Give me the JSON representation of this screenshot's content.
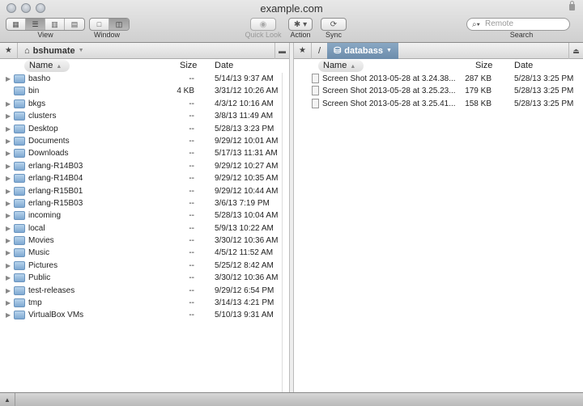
{
  "window": {
    "title": "example.com"
  },
  "toolbar": {
    "view_label": "View",
    "window_label": "Window",
    "quicklook_label": "Quick Look",
    "action_label": "Action",
    "sync_label": "Sync",
    "search_label": "Search",
    "search_placeholder": "Remote",
    "view_modes": [
      "icon-view",
      "list-view",
      "column-view",
      "coverflow-view"
    ],
    "view_selected": "list-view",
    "window_modes": [
      "single-pane",
      "dual-pane"
    ],
    "window_selected": "dual-pane"
  },
  "left": {
    "path": [
      {
        "label": "bshumate",
        "icon": "home-icon"
      }
    ],
    "columns": {
      "name": "Name",
      "size": "Size",
      "date": "Date"
    },
    "rows": [
      {
        "name": "basho",
        "size": "--",
        "date": "5/14/13 9:37 AM"
      },
      {
        "name": "bin",
        "size": "4 KB",
        "date": "3/31/12 10:26 AM",
        "alias": true
      },
      {
        "name": "bkgs",
        "size": "--",
        "date": "4/3/12 10:16 AM"
      },
      {
        "name": "clusters",
        "size": "--",
        "date": "3/8/13 11:49 AM"
      },
      {
        "name": "Desktop",
        "size": "--",
        "date": "5/28/13 3:23 PM"
      },
      {
        "name": "Documents",
        "size": "--",
        "date": "9/29/12 10:01 AM"
      },
      {
        "name": "Downloads",
        "size": "--",
        "date": "5/17/13 11:31 AM"
      },
      {
        "name": "erlang-R14B03",
        "size": "--",
        "date": "9/29/12 10:27 AM"
      },
      {
        "name": "erlang-R14B04",
        "size": "--",
        "date": "9/29/12 10:35 AM"
      },
      {
        "name": "erlang-R15B01",
        "size": "--",
        "date": "9/29/12 10:44 AM"
      },
      {
        "name": "erlang-R15B03",
        "size": "--",
        "date": "3/6/13 7:19 PM"
      },
      {
        "name": "incoming",
        "size": "--",
        "date": "5/28/13 10:04 AM"
      },
      {
        "name": "local",
        "size": "--",
        "date": "5/9/13 10:22 AM"
      },
      {
        "name": "Movies",
        "size": "--",
        "date": "3/30/12 10:36 AM"
      },
      {
        "name": "Music",
        "size": "--",
        "date": "4/5/12 11:52 AM"
      },
      {
        "name": "Pictures",
        "size": "--",
        "date": "5/25/12 8:42 AM"
      },
      {
        "name": "Public",
        "size": "--",
        "date": "3/30/12 10:36 AM"
      },
      {
        "name": "test-releases",
        "size": "--",
        "date": "9/29/12 6:54 PM"
      },
      {
        "name": "tmp",
        "size": "--",
        "date": "3/14/13 4:21 PM"
      },
      {
        "name": "VirtualBox VMs",
        "size": "--",
        "date": "5/10/13 9:31 AM"
      }
    ]
  },
  "right": {
    "path": [
      {
        "label": "/"
      },
      {
        "label": "databass",
        "icon": "drive-icon"
      }
    ],
    "columns": {
      "name": "Name",
      "size": "Size",
      "date": "Date"
    },
    "rows": [
      {
        "name": "Screen Shot 2013-05-28 at 3.24.38...",
        "size": "287 KB",
        "date": "5/28/13 3:25 PM"
      },
      {
        "name": "Screen Shot 2013-05-28 at 3.25.23...",
        "size": "179 KB",
        "date": "5/28/13 3:25 PM"
      },
      {
        "name": "Screen Shot 2013-05-28 at 3.25.41...",
        "size": "158 KB",
        "date": "5/28/13 3:25 PM"
      }
    ]
  }
}
